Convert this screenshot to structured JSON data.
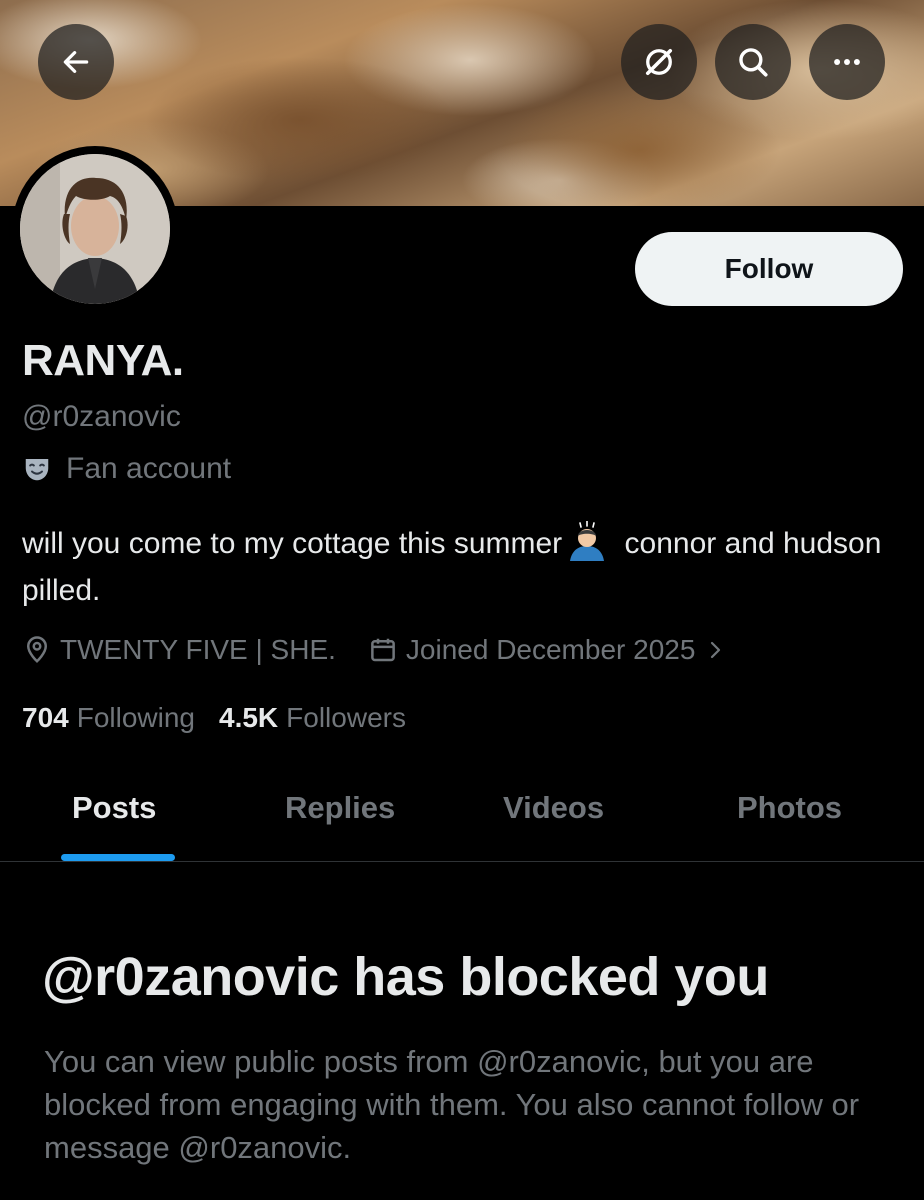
{
  "header": {
    "back_icon": "arrow-left-icon",
    "grok_icon": "grok-slash-circle-icon",
    "search_icon": "search-icon",
    "more_icon": "more-horizontal-icon"
  },
  "profile": {
    "display_name": "RANYA.",
    "handle": "@r0zanovic",
    "category": "Fan account",
    "category_icon": "theater-mask-icon",
    "bio_part1": "will you come to my cottage this summer",
    "bio_emoji": "person-bowing-emoji",
    "bio_part2": " connor and hudson pilled.",
    "location": "TWENTY FIVE | SHE.",
    "joined": "Joined December 2025",
    "following_count": "704",
    "following_label": "Following",
    "followers_count": "4.5K",
    "followers_label": "Followers",
    "follow_button": "Follow"
  },
  "tabs": [
    {
      "label": "Posts",
      "active": true
    },
    {
      "label": "Replies",
      "active": false
    },
    {
      "label": "Videos",
      "active": false
    },
    {
      "label": "Photos",
      "active": false
    }
  ],
  "blocked": {
    "title": "@r0zanovic has blocked you",
    "body": "You can view public posts from @r0zanovic, but you are blocked from engaging with them. You also cannot follow or message @r0zanovic."
  },
  "colors": {
    "accent": "#1d9bf0",
    "muted_text": "#71767b",
    "primary_text": "#e7e9ea",
    "background": "#000000"
  }
}
